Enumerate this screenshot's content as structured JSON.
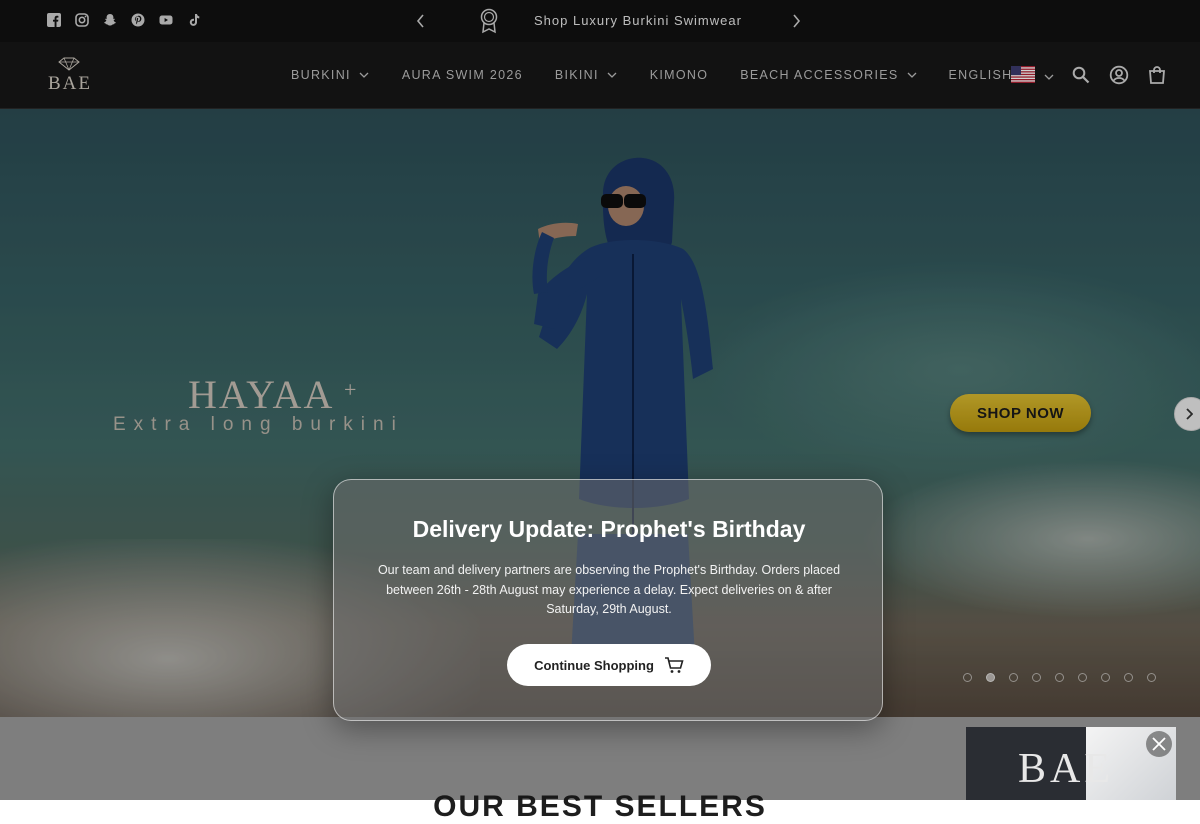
{
  "announcement": {
    "text": "Shop Luxury Burkini Swimwear",
    "socials": [
      "facebook-icon",
      "instagram-icon",
      "snapchat-icon",
      "pinterest-icon",
      "youtube-icon",
      "tiktok-icon"
    ]
  },
  "header": {
    "logo_text": "BAE",
    "nav": [
      {
        "label": "BURKINI",
        "has_dropdown": true
      },
      {
        "label": "AURA SWIM 2026",
        "has_dropdown": false
      },
      {
        "label": "BIKINI",
        "has_dropdown": true
      },
      {
        "label": "KIMONO",
        "has_dropdown": false
      },
      {
        "label": "BEACH ACCESSORIES",
        "has_dropdown": true
      },
      {
        "label": "ENGLISH",
        "has_dropdown": true
      }
    ],
    "icons": [
      "search-icon",
      "account-icon",
      "cart-icon"
    ]
  },
  "hero": {
    "brand_title": "HAYAA",
    "brand_plus": "+",
    "brand_subtitle": "Extra long burkini",
    "cta_label": "SHOP NOW",
    "slide_count": 9,
    "active_slide": 1
  },
  "modal": {
    "title": "Delivery Update: Prophet's Birthday",
    "body": "Our team and delivery partners are observing the Prophet's Birthday. Orders placed between 26th - 28th August may experience a delay. Expect deliveries on & after Saturday, 29th August.",
    "button_label": "Continue Shopping"
  },
  "section": {
    "heading": "OUR BEST SELLERS"
  },
  "promo": {
    "logo_text": "BAE"
  },
  "colors": {
    "topbar_bg": "#111111",
    "header_bg": "#161616",
    "cta_gold": "#c9a820",
    "modal_button_bg": "#ffffff"
  }
}
